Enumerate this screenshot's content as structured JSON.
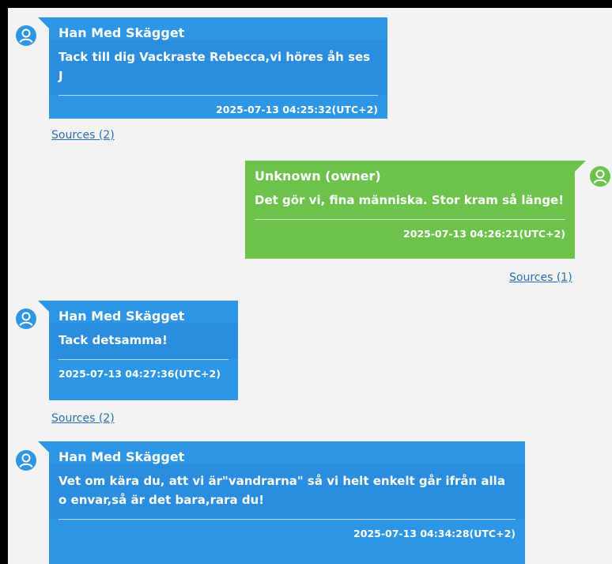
{
  "messages": [
    {
      "sender": "Han Med Skägget",
      "text": "Tack till dig Vackraste Rebecca,vi höres åh ses J",
      "timestamp": "2025-07-13 04:25:32(UTC+2)",
      "sources": "Sources (2)",
      "side": "left",
      "color": "#2e96e6"
    },
    {
      "sender": "Unknown (owner)",
      "text": "Det gör vi, fina människa. Stor kram så länge!",
      "timestamp": "2025-07-13 04:26:21(UTC+2)",
      "sources": "Sources (1)",
      "side": "right",
      "color": "#6cc24a"
    },
    {
      "sender": "Han Med Skägget",
      "text": "Tack detsamma!",
      "timestamp": "2025-07-13 04:27:36(UTC+2)",
      "sources": "Sources (2)",
      "side": "left",
      "color": "#2e96e6"
    },
    {
      "sender": "Han Med Skägget",
      "text": "Vet om kära du, att vi är\"vandrarna\" så vi helt enkelt går ifrån alla o envar,så är det bara,rara du!",
      "timestamp": "2025-07-13 04:34:28(UTC+2)",
      "side": "left",
      "color": "#2e96e6"
    }
  ],
  "icons": {
    "avatar_left": "user-avatar-icon",
    "avatar_right": "user-avatar-icon"
  }
}
